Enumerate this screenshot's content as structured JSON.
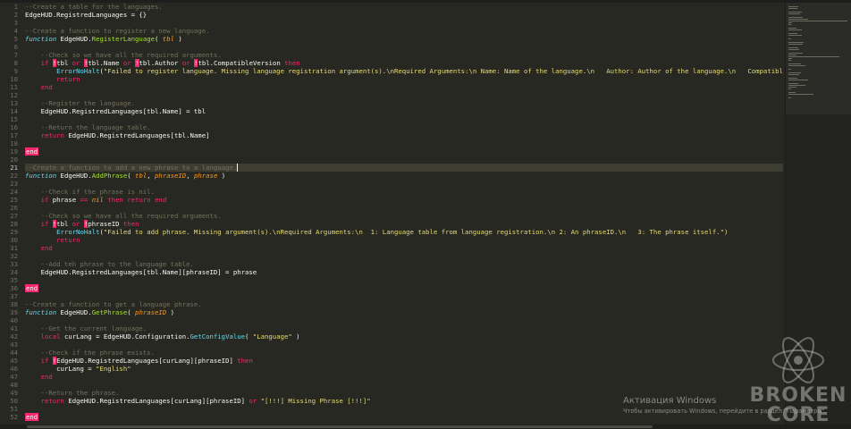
{
  "editor": {
    "active_line": 21,
    "lines": [
      {
        "n": 1,
        "t": [
          [
            "c",
            "--Create a table for the languages."
          ]
        ]
      },
      {
        "n": 2,
        "t": [
          [
            "",
            "EdgeHUD.RegistredLanguages = {}"
          ]
        ]
      },
      {
        "n": 3,
        "t": []
      },
      {
        "n": 4,
        "t": [
          [
            "c",
            "--Create a function to register a new language."
          ]
        ]
      },
      {
        "n": 5,
        "t": [
          [
            "f",
            "function"
          ],
          [
            "",
            " EdgeHUD."
          ],
          [
            "fn",
            "RegisterLanguage"
          ],
          [
            "",
            "( "
          ],
          [
            "p",
            "tbl"
          ],
          [
            "",
            " )"
          ]
        ]
      },
      {
        "n": 6,
        "t": []
      },
      {
        "n": 7,
        "t": [
          [
            "c",
            "    --Check so we have all the required arguments."
          ]
        ]
      },
      {
        "n": 8,
        "t": [
          [
            "k",
            "    if"
          ],
          [
            "",
            " "
          ],
          [
            "mark",
            "!"
          ],
          [
            "",
            "tbl "
          ],
          [
            "k",
            "or"
          ],
          [
            "",
            " "
          ],
          [
            "mark",
            "!"
          ],
          [
            "",
            "tbl.Name "
          ],
          [
            "k",
            "or"
          ],
          [
            "",
            " "
          ],
          [
            "mark",
            "!"
          ],
          [
            "",
            "tbl.Author "
          ],
          [
            "k",
            "or"
          ],
          [
            "",
            " "
          ],
          [
            "mark",
            "!"
          ],
          [
            "",
            "tbl.CompatibleVersion "
          ],
          [
            "k",
            "then"
          ]
        ]
      },
      {
        "n": 9,
        "t": [
          [
            "",
            "        "
          ],
          [
            "b",
            "ErrorNoHalt"
          ],
          [
            "",
            "("
          ],
          [
            "s",
            "\"Failed to register language. Missing language registration argument(s).\\nRequired Arguments:\\n Name: Name of the language.\\n   Author: Author of the language.\\n   CompatibleVersion: Lat"
          ]
        ]
      },
      {
        "n": 10,
        "t": [
          [
            "k",
            "        return"
          ]
        ]
      },
      {
        "n": 11,
        "t": [
          [
            "k",
            "    end"
          ]
        ]
      },
      {
        "n": 12,
        "t": []
      },
      {
        "n": 13,
        "t": [
          [
            "c",
            "    --Register the language."
          ]
        ]
      },
      {
        "n": 14,
        "t": [
          [
            "",
            "    EdgeHUD.RegistredLanguages[tbl.Name] = tbl"
          ]
        ]
      },
      {
        "n": 15,
        "t": []
      },
      {
        "n": 16,
        "t": [
          [
            "c",
            "    --Return the language table."
          ]
        ]
      },
      {
        "n": 17,
        "t": [
          [
            "k",
            "    return"
          ],
          [
            "",
            " EdgeHUD.RegistredLanguages[tbl.Name]"
          ]
        ]
      },
      {
        "n": 18,
        "t": []
      },
      {
        "n": 19,
        "t": [
          [
            "endhl",
            "end"
          ]
        ]
      },
      {
        "n": 20,
        "t": []
      },
      {
        "n": 21,
        "t": [
          [
            "c",
            "--Create a function to add a new phrase to a language."
          ],
          [
            "caret",
            ""
          ]
        ]
      },
      {
        "n": 22,
        "t": [
          [
            "f",
            "function"
          ],
          [
            "",
            " EdgeHUD."
          ],
          [
            "fn",
            "AddPhrase"
          ],
          [
            "",
            "( "
          ],
          [
            "p",
            "tbl"
          ],
          [
            "",
            ", "
          ],
          [
            "p",
            "phraseID"
          ],
          [
            "",
            ", "
          ],
          [
            "p",
            "phrase"
          ],
          [
            "",
            " )"
          ]
        ]
      },
      {
        "n": 23,
        "t": []
      },
      {
        "n": 24,
        "t": [
          [
            "c",
            "    --Check if the phrase is nil."
          ]
        ]
      },
      {
        "n": 25,
        "t": [
          [
            "k",
            "    if"
          ],
          [
            "",
            " phrase "
          ],
          [
            "k",
            "=="
          ],
          [
            "",
            " "
          ],
          [
            "p",
            "nil"
          ],
          [
            "",
            " "
          ],
          [
            "k",
            "then return end"
          ]
        ]
      },
      {
        "n": 26,
        "t": []
      },
      {
        "n": 27,
        "t": [
          [
            "c",
            "    --Check so we have all the required arguments."
          ]
        ]
      },
      {
        "n": 28,
        "t": [
          [
            "k",
            "    if"
          ],
          [
            "",
            " "
          ],
          [
            "mark",
            "!"
          ],
          [
            "",
            "tbl "
          ],
          [
            "k",
            "or"
          ],
          [
            "",
            " "
          ],
          [
            "mark",
            "!"
          ],
          [
            "",
            "phraseID "
          ],
          [
            "k",
            "then"
          ]
        ]
      },
      {
        "n": 29,
        "t": [
          [
            "",
            "        "
          ],
          [
            "b",
            "ErrorNoHalt"
          ],
          [
            "",
            "("
          ],
          [
            "s",
            "\"Failed to add phrase. Missing argument(s).\\nRequired Arguments:\\n  1: Language table from language registration.\\n 2: An phraseID.\\n   3: The phrase itself.\")"
          ]
        ]
      },
      {
        "n": 30,
        "t": [
          [
            "k",
            "        return"
          ]
        ]
      },
      {
        "n": 31,
        "t": [
          [
            "k",
            "    end"
          ]
        ]
      },
      {
        "n": 32,
        "t": []
      },
      {
        "n": 33,
        "t": [
          [
            "c",
            "    --Add teh phrase to the language table."
          ]
        ]
      },
      {
        "n": 34,
        "t": [
          [
            "",
            "    EdgeHUD.RegistredLanguages[tbl.Name][phraseID] = phrase"
          ]
        ]
      },
      {
        "n": 35,
        "t": []
      },
      {
        "n": 36,
        "t": [
          [
            "endhl",
            "end"
          ]
        ]
      },
      {
        "n": 37,
        "t": []
      },
      {
        "n": 38,
        "t": [
          [
            "c",
            "--Create a function to get a language phrase."
          ]
        ]
      },
      {
        "n": 39,
        "t": [
          [
            "f",
            "function"
          ],
          [
            "",
            " EdgeHUD."
          ],
          [
            "fn",
            "GetPhrase"
          ],
          [
            "",
            "( "
          ],
          [
            "p",
            "phraseID"
          ],
          [
            "",
            " )"
          ]
        ]
      },
      {
        "n": 40,
        "t": []
      },
      {
        "n": 41,
        "t": [
          [
            "c",
            "    --Get the current language."
          ]
        ]
      },
      {
        "n": 42,
        "t": [
          [
            "k",
            "    local"
          ],
          [
            "",
            " curLang = EdgeHUD.Configuration."
          ],
          [
            "b",
            "GetConfigValue"
          ],
          [
            "",
            "( "
          ],
          [
            "s",
            "\"Language\""
          ],
          [
            "",
            " )"
          ]
        ]
      },
      {
        "n": 43,
        "t": []
      },
      {
        "n": 44,
        "t": [
          [
            "c",
            "    --Check if the phrase exists."
          ]
        ]
      },
      {
        "n": 45,
        "t": [
          [
            "k",
            "    if"
          ],
          [
            "",
            " "
          ],
          [
            "mark",
            "!"
          ],
          [
            "",
            "EdgeHUD.RegistredLanguages[curLang][phraseID] "
          ],
          [
            "k",
            "then"
          ]
        ]
      },
      {
        "n": 46,
        "t": [
          [
            "",
            "        curLang = "
          ],
          [
            "s",
            "\"English\""
          ]
        ]
      },
      {
        "n": 47,
        "t": [
          [
            "k",
            "    end"
          ]
        ]
      },
      {
        "n": 48,
        "t": []
      },
      {
        "n": 49,
        "t": [
          [
            "c",
            "    --Return the phrase."
          ]
        ]
      },
      {
        "n": 50,
        "t": [
          [
            "k",
            "    return"
          ],
          [
            "",
            " EdgeHUD.RegistredLanguages[curLang][phraseID] "
          ],
          [
            "k",
            "or"
          ],
          [
            "",
            " "
          ],
          [
            "s",
            "\"[!!!] Missing Phrase [!!!]\""
          ]
        ]
      },
      {
        "n": 51,
        "t": []
      },
      {
        "n": 52,
        "t": [
          [
            "endhl",
            "end"
          ]
        ]
      }
    ]
  },
  "watermark": {
    "activation_title": "Активация Windows",
    "activation_subtitle": "Чтобы активировать Windows, перейдите в раздел \"Параметры\".",
    "logo_word_1": "BROKEN",
    "logo_word_2": "CORE"
  },
  "colors": {
    "background": "#272822",
    "comment": "#75715e",
    "keyword": "#f92672",
    "function_name": "#a6e22e",
    "builtin": "#66d9ef",
    "parameter": "#fd971f",
    "string": "#e6db74"
  }
}
